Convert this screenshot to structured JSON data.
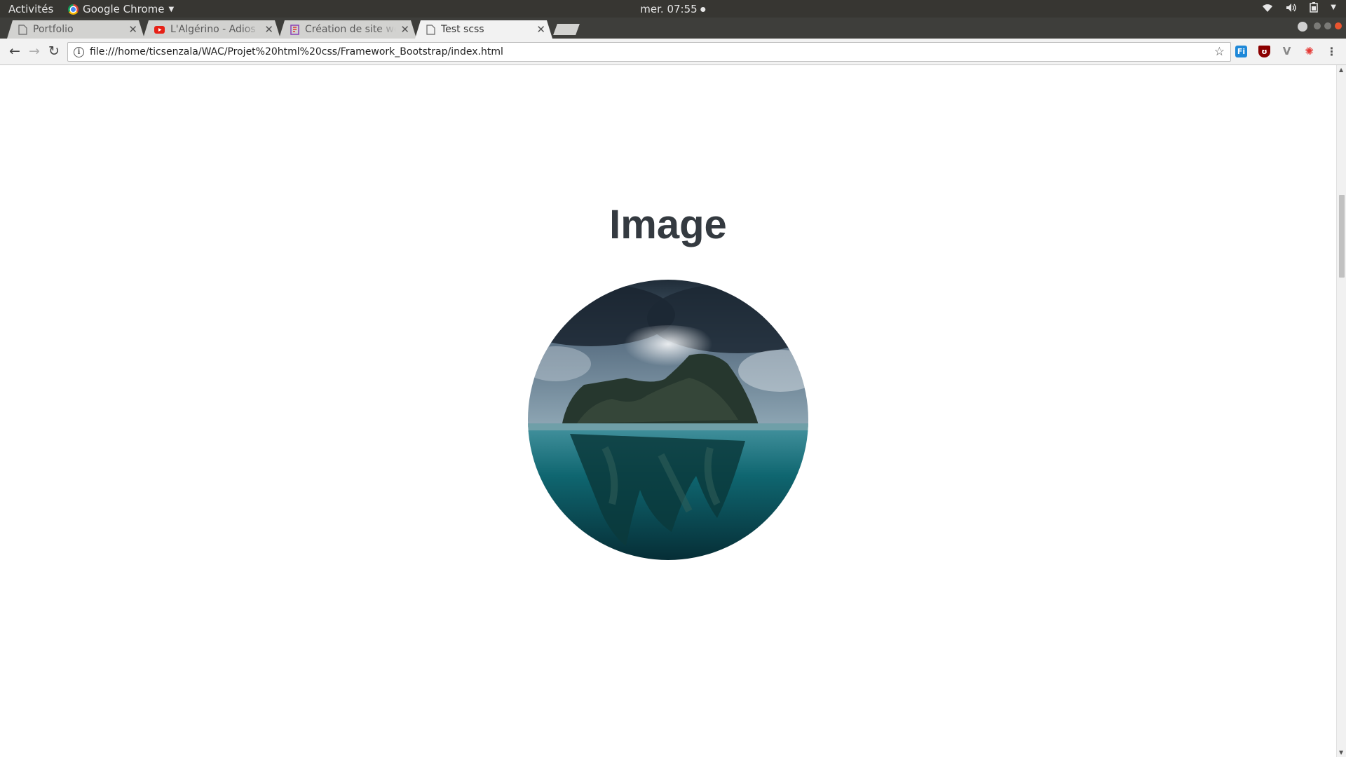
{
  "topbar": {
    "activities": "Activités",
    "app_name": "Google Chrome",
    "clock": "mer. 07:55"
  },
  "tabs": [
    {
      "title": "Portfolio",
      "favicon": "document-icon",
      "active": false
    },
    {
      "title": "L'Algérino - Adios fi",
      "favicon": "youtube-icon",
      "active": false
    },
    {
      "title": "Création de site we",
      "favicon": "site-icon",
      "active": false
    },
    {
      "title": "Test scss",
      "favicon": "document-icon",
      "active": true
    }
  ],
  "toolbar": {
    "url": "file:///home/ticsenzala/WAC/Projet%20html%20css/Framework_Bootstrap/index.html"
  },
  "page": {
    "heading": "Image"
  },
  "colors": {
    "heading": "#343a40",
    "topbar": "#373632",
    "tabstrip": "#3e3e3b",
    "youtube": "#e62117"
  }
}
